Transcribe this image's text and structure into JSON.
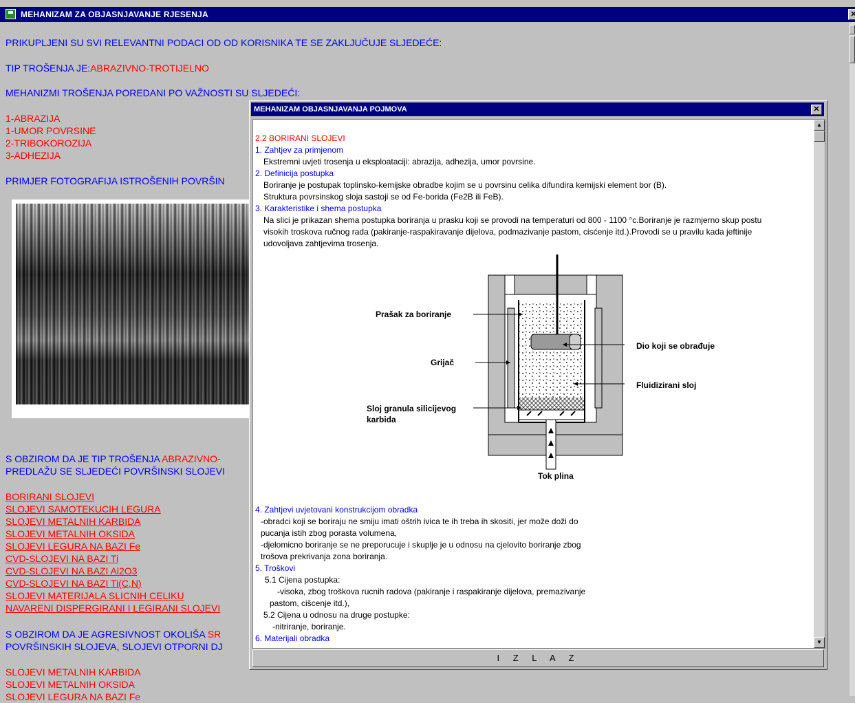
{
  "window": {
    "title": "MEHANIZAM ZA OBJASNJAVANJE RJESENJA",
    "close_glyph": "✕"
  },
  "main": {
    "intro": "PRIKUPLJENI SU SVI RELEVANTNI PODACI OD OD KORISNIKA TE SE ZAKLJUČUJE SLJEDEĆE:",
    "wear_type_label": "TIP TROŠENJA JE:",
    "wear_type_value": "ABRAZIVNO-TROTIJELNO",
    "mechanisms_heading": "MEHANIZMI TROŠENJA POREDANI PO VAŽNOSTI SU SLJEDEĆI:",
    "mechanisms": [
      "1-ABRAZIJA",
      "1-UMOR POVRSINE",
      "2-TRIBOKOROZIJA",
      "3-ADHEZIJA"
    ],
    "photo_heading": "PRIMJER FOTOGRAFIJA ISTROŠENIH POVRŠIN",
    "suggest_line1_a": "S OBZIROM DA JE TIP TROŠENJA ",
    "suggest_line1_b": "ABRAZIVNO-",
    "suggest_line2": "PREDLAŽU SE SLJEDEĆI POVRŠINSKI SLOJEVI",
    "layers": [
      "BORIRANI SLOJEVI",
      "SLOJEVI SAMOTEKUCIH LEGURA",
      "SLOJEVI METALNIH KARBIDA",
      "SLOJEVI METALNIH OKSIDA",
      "SLOJEVI LEGURA NA BAZI Fe",
      "CVD-SLOJEVI NA BAZI Ti",
      "CVD-SLOJEVI NA BAZI Al2O3",
      "CVD-SLOJEVI NA BAZI Ti(C,N)",
      "SLOJEVI MATERIJALA SLICNIH CELIKU",
      "NAVARENI DISPERGIRANI I LEGIRANI SLOJEVI"
    ],
    "aggr_line1_a": "S OBZIROM DA JE AGRESIVNOST OKOLIŠA ",
    "aggr_line1_b": "SR",
    "aggr_line2": "POVRŠINSKIH SLOJEVA, SLOJEVI OTPORNI DJ",
    "bottom_list": [
      "SLOJEVI METALNIH KARBIDA",
      "SLOJEVI METALNIH OKSIDA",
      "SLOJEVI LEGURA NA BAZI Fe"
    ]
  },
  "dialog": {
    "title": "MEHANIZAM OBJASNJAVANJA POJMOVA",
    "close_glyph": "✕",
    "heading": "2.2 BORIRANI SLOJEVI",
    "s1_title": "1. Zahtjev za primjenom",
    "s1_text": "Ekstremni uvjeti trosenja u eksploataciji: abrazija, adhezija, umor povrsine.",
    "s2_title": "2. Definicija postupka",
    "s2_text1": "Boriranje je postupak toplinsko-kemijske obradbe kojim se u povrsinu celika difundira kemijski element bor (B).",
    "s2_text2": "Struktura povrsinskog sloja sastoji se od Fe-borida (Fe2B ili FeB).",
    "s3_title": "3. Karakteristike i shema postupka",
    "s3_text1": "Na slici je prikazan shema postupka boriranja u prasku koji se provodi na temperaturi od 800 - 1100 °c.Boriranje je razmjerno skup postu",
    "s3_text2": "visokih troskova ručnog rada (pakiranje-raspakiravanje dijelova, podmazivanje pastom, cisćenje itd.).Provodi se u pravilu kada jeftinije",
    "s3_text3": "udovoljava zahtjevima trosenja.",
    "diagram": {
      "label_powder": "Prašak za boriranje",
      "label_heater": "Grijač",
      "label_layer_1": "Sloj granula silicijevog",
      "label_layer_2": "karbida",
      "label_part": "Dio koji se obrađuje",
      "label_fluid": "Fluidizirani sloj",
      "label_gas": "Tok plina"
    },
    "s4_title": "4. Zahtjevi uvjetovani konstrukcijom obradka",
    "s4_l1": "-obradci koji se boriraju ne smiju imati oštrih ivica te ih treba ih skositi, jer može doži do",
    "s4_l2": "pucanja istih zbog porasta  volumena,",
    "s4_l3": "-djelomicno boriranje se ne preporucuje i skuplje je u odnosu na cjelovito boriranje zbog",
    "s4_l4": "trošova prekrivanja zona boriranja.",
    "s5_title": "5. Troškovi",
    "s5_1": "5.1 Cijena postupka:",
    "s5_1a": "-visoka, zbog troškova rucnih radova (pakiranje i raspakiranje dijelova, premazivanje",
    "s5_1b": "pastom, cišcenje itd.),",
    "s5_2": "5.2 Cijena u odnosu na druge postupke:",
    "s5_2a": "-nitriranje, boriranje.",
    "s6_title": "6. Materijali obradka",
    "exit_label": "I Z L A Z"
  }
}
